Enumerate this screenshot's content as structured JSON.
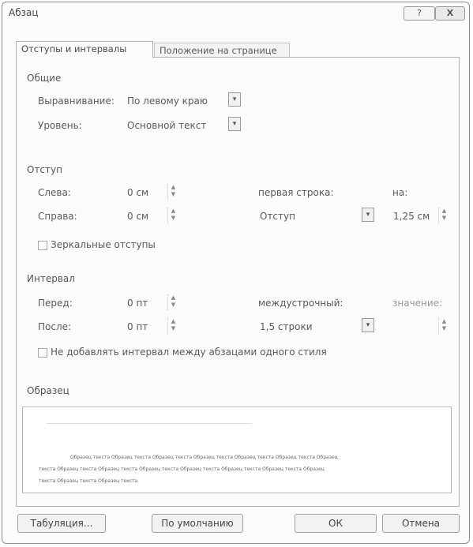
{
  "window": {
    "title": "Абзац",
    "help_label": "?",
    "close_label": "X"
  },
  "tabs": [
    {
      "label": "Отступы и интервалы",
      "selected": true
    },
    {
      "label": "Положение на странице",
      "selected": false
    }
  ],
  "general": {
    "section_label": "Общие",
    "alignment_label": "Выравнивание:",
    "alignment_value": "По левому краю",
    "level_label": "Уровень:",
    "level_value": "Основной текст"
  },
  "indent": {
    "section_label": "Отступ",
    "left_label": "Слева:",
    "left_value": "0 см",
    "right_label": "Справа:",
    "right_value": "0 см",
    "first_line_label": "первая строка:",
    "first_line_value": "Отступ",
    "by_label": "на:",
    "by_value": "1,25 см",
    "mirror_label": "Зеркальные отступы"
  },
  "spacing": {
    "section_label": "Интервал",
    "before_label": "Перед:",
    "before_value": "0 пт",
    "after_label": "После:",
    "after_value": "0 пт",
    "line_spacing_label": "междустрочный:",
    "line_spacing_value": "1,5 строки",
    "value_label": "значение:",
    "value_value": "",
    "no_space_label": "Не добавлять интервал между абзацами одного стиля"
  },
  "preview": {
    "section_label": "Образец",
    "line1": "Образец текста Образец текста Образец текста Образец текста Образец текста Образец текста Образец",
    "line2": "текста Образец текста Образец текста Образец текста Образец текста Образец текста Образец текста Образец",
    "line3": "текста Образец текста Образец текста"
  },
  "buttons": {
    "tabs": "Табуляция...",
    "default": "По умолчанию",
    "ok": "ОК",
    "cancel": "Отмена"
  },
  "icons": {
    "dropdown": "▾",
    "spin_up": "▲",
    "spin_down": "▼"
  }
}
